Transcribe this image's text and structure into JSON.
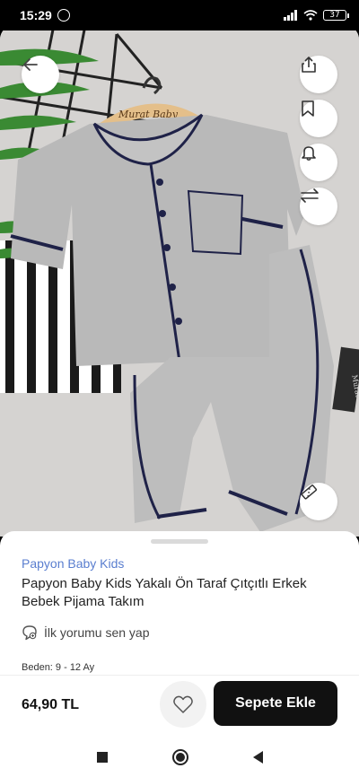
{
  "status_bar": {
    "time": "15:29",
    "battery": "37"
  },
  "image": {
    "hanger_label": "Murat Baby",
    "tag_label": "Murat"
  },
  "product": {
    "brand": "Papyon Baby Kids",
    "title": "Papyon Baby Kids Yakalı Ön Taraf Çıtçıtlı Erkek Bebek Pijama Takım",
    "review_prompt": "İlk yorumu sen yap",
    "size_line": "Beden: 9 - 12 Ay"
  },
  "buy_bar": {
    "price": "64,90 TL",
    "cart_label": "Sepete Ekle"
  },
  "icons": {
    "back": "arrow-left-icon",
    "share": "share-icon",
    "bookmark": "bookmark-icon",
    "bell": "bell-icon",
    "compare": "compare-arrows-icon",
    "measure": "ruler-icon",
    "review": "comment-icon",
    "favorite": "heart-icon"
  },
  "colors": {
    "brand": "#5a7ecf",
    "cart_button": "#111111",
    "piping": "#1f2248"
  }
}
